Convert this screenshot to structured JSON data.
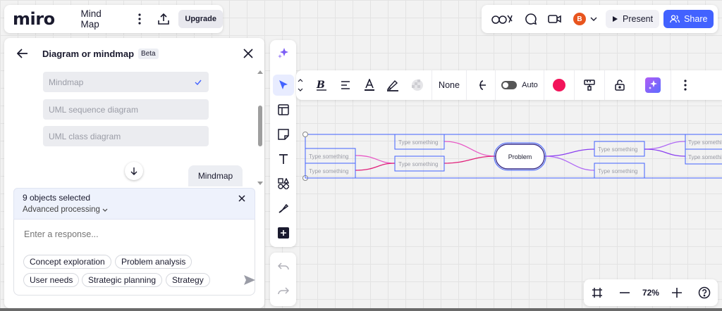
{
  "app": {
    "logo": "miro",
    "board_name": "Mind Map",
    "upgrade_label": "Upgrade"
  },
  "topbar": {
    "present_label": "Present",
    "share_label": "Share",
    "user_initial": "B"
  },
  "assistant": {
    "title": "Diagram or mindmap",
    "badge": "Beta",
    "options": [
      {
        "label": "Mindmap",
        "selected": true
      },
      {
        "label": "UML sequence diagram",
        "selected": false
      },
      {
        "label": "UML class diagram",
        "selected": false
      }
    ],
    "chat_bubble": "Mindmap",
    "selection": {
      "count_text": "9 objects selected",
      "processing_label": "Advanced processing"
    },
    "response_placeholder": "Enter a response...",
    "chips": [
      "Concept exploration",
      "Problem analysis",
      "User needs",
      "Strategic planning",
      "Strategy"
    ]
  },
  "context_toolbar": {
    "fill_label": "None",
    "auto_label": "Auto",
    "color": "#f2145a"
  },
  "zoom": {
    "level": "72%"
  },
  "mindmap": {
    "center_label": "Problem",
    "node_placeholder": "Type something"
  },
  "colors": {
    "accent": "#4262ff",
    "branch_pink": "#e0207a",
    "branch_purple": "#8a3ff0",
    "selection": "#4262ff"
  }
}
